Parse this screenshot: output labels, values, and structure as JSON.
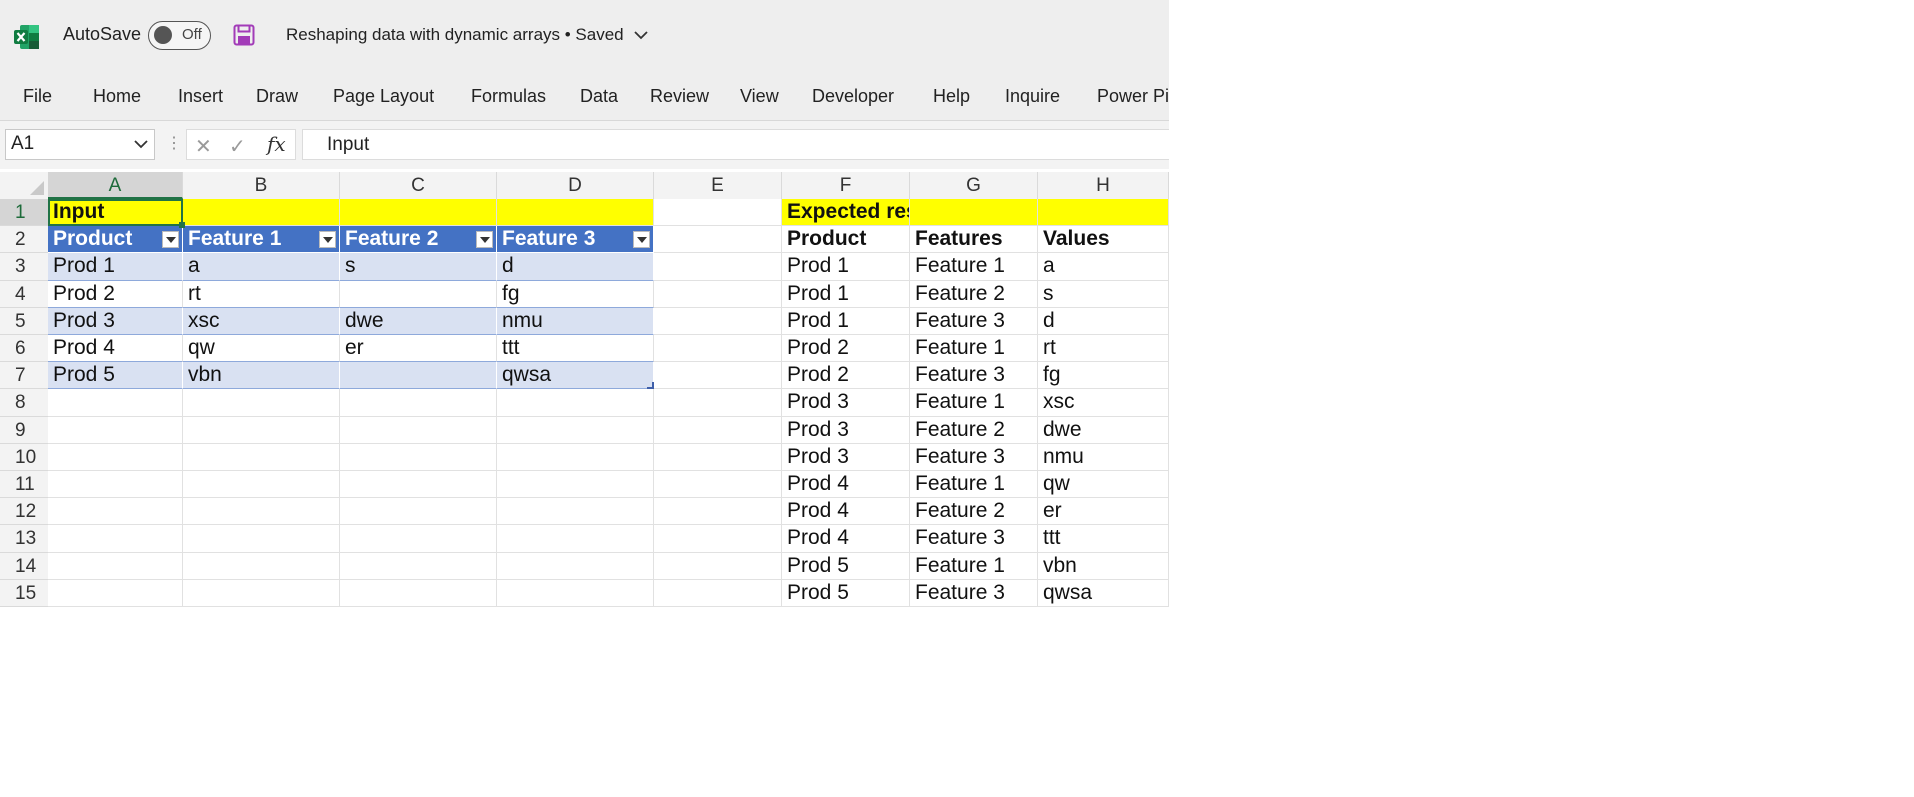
{
  "titlebar": {
    "autosave_label": "AutoSave",
    "toggle_state": "Off",
    "doc_title": "Reshaping data with dynamic arrays • Saved",
    "app_icon": "excel-icon",
    "save_icon": "save-icon",
    "brand_color": "#217346",
    "save_icon_color": "#a23bb8"
  },
  "ribbon": {
    "tabs": [
      "File",
      "Home",
      "Insert",
      "Draw",
      "Page Layout",
      "Formulas",
      "Data",
      "Review",
      "View",
      "Developer",
      "Help",
      "Inquire",
      "Power Pivot"
    ]
  },
  "formula_bar": {
    "name_box": "A1",
    "fx_label": "fx",
    "value": "Input"
  },
  "grid": {
    "columns": [
      "A",
      "B",
      "C",
      "D",
      "E",
      "F",
      "G",
      "H"
    ],
    "rows": [
      "1",
      "2",
      "3",
      "4",
      "5",
      "6",
      "7",
      "8",
      "9",
      "10",
      "11",
      "12",
      "13",
      "14",
      "15"
    ],
    "active_cell": "A1",
    "colors": {
      "highlight": "#ffff00",
      "table_header": "#4472c4",
      "table_band": "#d9e1f2",
      "selection": "#217346"
    },
    "input": {
      "title": "Input",
      "headers": [
        "Product",
        "Feature 1",
        "Feature 2",
        "Feature 3"
      ],
      "rows": [
        [
          "Prod 1",
          "a",
          "s",
          "d"
        ],
        [
          "Prod 2",
          "rt",
          "",
          "fg"
        ],
        [
          "Prod 3",
          "xsc",
          "dwe",
          "nmu"
        ],
        [
          "Prod 4",
          "qw",
          "er",
          "ttt"
        ],
        [
          "Prod 5",
          "vbn",
          "",
          "qwsa"
        ]
      ]
    },
    "expected": {
      "title": "Expected result",
      "headers": [
        "Product",
        "Features",
        "Values"
      ],
      "rows": [
        [
          "Prod 1",
          "Feature 1",
          "a"
        ],
        [
          "Prod 1",
          "Feature 2",
          "s"
        ],
        [
          "Prod 1",
          "Feature 3",
          "d"
        ],
        [
          "Prod 2",
          "Feature 1",
          "rt"
        ],
        [
          "Prod 2",
          "Feature 3",
          "fg"
        ],
        [
          "Prod 3",
          "Feature 1",
          "xsc"
        ],
        [
          "Prod 3",
          "Feature 2",
          "dwe"
        ],
        [
          "Prod 3",
          "Feature 3",
          "nmu"
        ],
        [
          "Prod 4",
          "Feature 1",
          "qw"
        ],
        [
          "Prod 4",
          "Feature 2",
          "er"
        ],
        [
          "Prod 4",
          "Feature 3",
          "ttt"
        ],
        [
          "Prod 5",
          "Feature 1",
          "vbn"
        ],
        [
          "Prod 5",
          "Feature 3",
          "qwsa"
        ]
      ]
    }
  }
}
